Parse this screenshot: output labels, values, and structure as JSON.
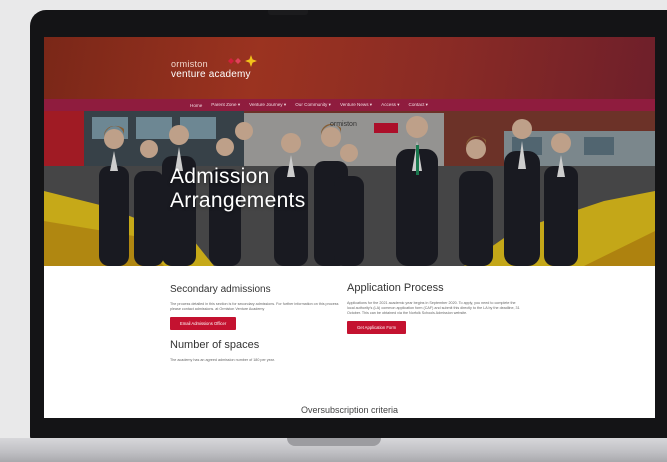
{
  "header": {
    "logo_top": "ormiston",
    "logo_main": "venture academy",
    "nav": [
      "Home",
      "Parent Zone ▾",
      "Venture Journey ▾",
      "Our Community ▾",
      "Venture News ▾",
      "Access ▾",
      "Contact ▾"
    ]
  },
  "hero": {
    "title_line1": "Admission",
    "title_line2": "Arrangements",
    "sign_text": "ormiston"
  },
  "secondary": {
    "title": "Secondary admissions",
    "text": "The process detailed in this section is for secondary admissions. For further information on this process please contact admissions. at Ormiston Venture Academy",
    "button": "Email Admissions Officer"
  },
  "spaces": {
    "title": "Number of spaces",
    "text": "The academy has an agreed admission number of 180 per year."
  },
  "application": {
    "title": "Application Process",
    "text": "Applications for the 2021 academic year begins in September 2020. To apply, you need to complete the local authority's (LA) common application form (CAF) and submit this directly to the LA by the deadline, 31 October. This can be obtained via the Norfolk Schools Admission website.",
    "button": "Get Application Form"
  },
  "oversubscription": {
    "title": "Oversubscription criteria"
  },
  "colors": {
    "accent": "#c41230",
    "nav": "#8f1c3e",
    "header": "#8a2b25"
  }
}
